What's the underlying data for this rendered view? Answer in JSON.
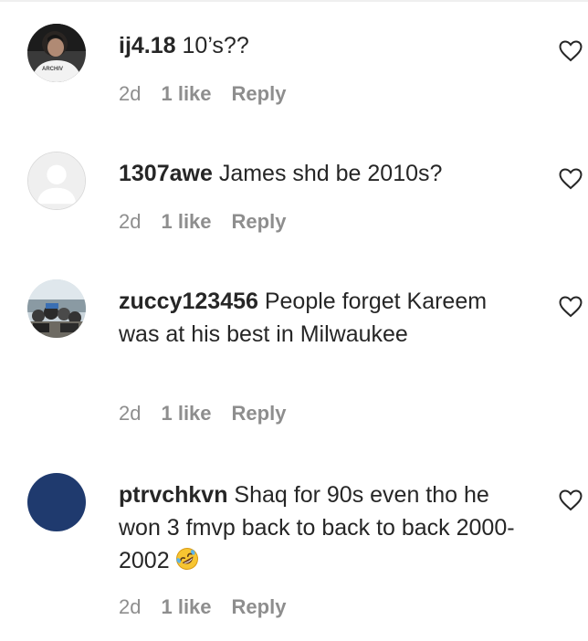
{
  "comments": [
    {
      "username": "ij4.18",
      "text": " 10’s??",
      "time": "2d",
      "likes": "1 like",
      "reply": "Reply",
      "avatar": "photo-avatar-dark-hair-white-shirt"
    },
    {
      "username": "1307awe",
      "text": " James shd be 2010s?",
      "time": "2d",
      "likes": "1 like",
      "reply": "Reply",
      "avatar": "default-avatar-grey"
    },
    {
      "username": "zuccy123456",
      "text": " People forget Kareem was at his best in Milwaukee",
      "time": "2d",
      "likes": "1 like",
      "reply": "Reply",
      "avatar": "photo-avatar-group-outdoors"
    },
    {
      "username": "ptrvchkvn",
      "text": " Shaq for 90s even tho he won 3 fmvp back to back to back 2000-2002",
      "emoji": "rolling-on-floor-laughing-emoji",
      "time": "2d",
      "likes": "1 like",
      "reply": "Reply",
      "avatar": "solid-avatar-navy"
    }
  ],
  "colors": {
    "text": "#262626",
    "muted": "#8e8e8e",
    "navy_avatar": "#1f3a6e",
    "default_avatar_bg": "#efefef"
  },
  "icons": {
    "like": "heart-outline-icon"
  }
}
